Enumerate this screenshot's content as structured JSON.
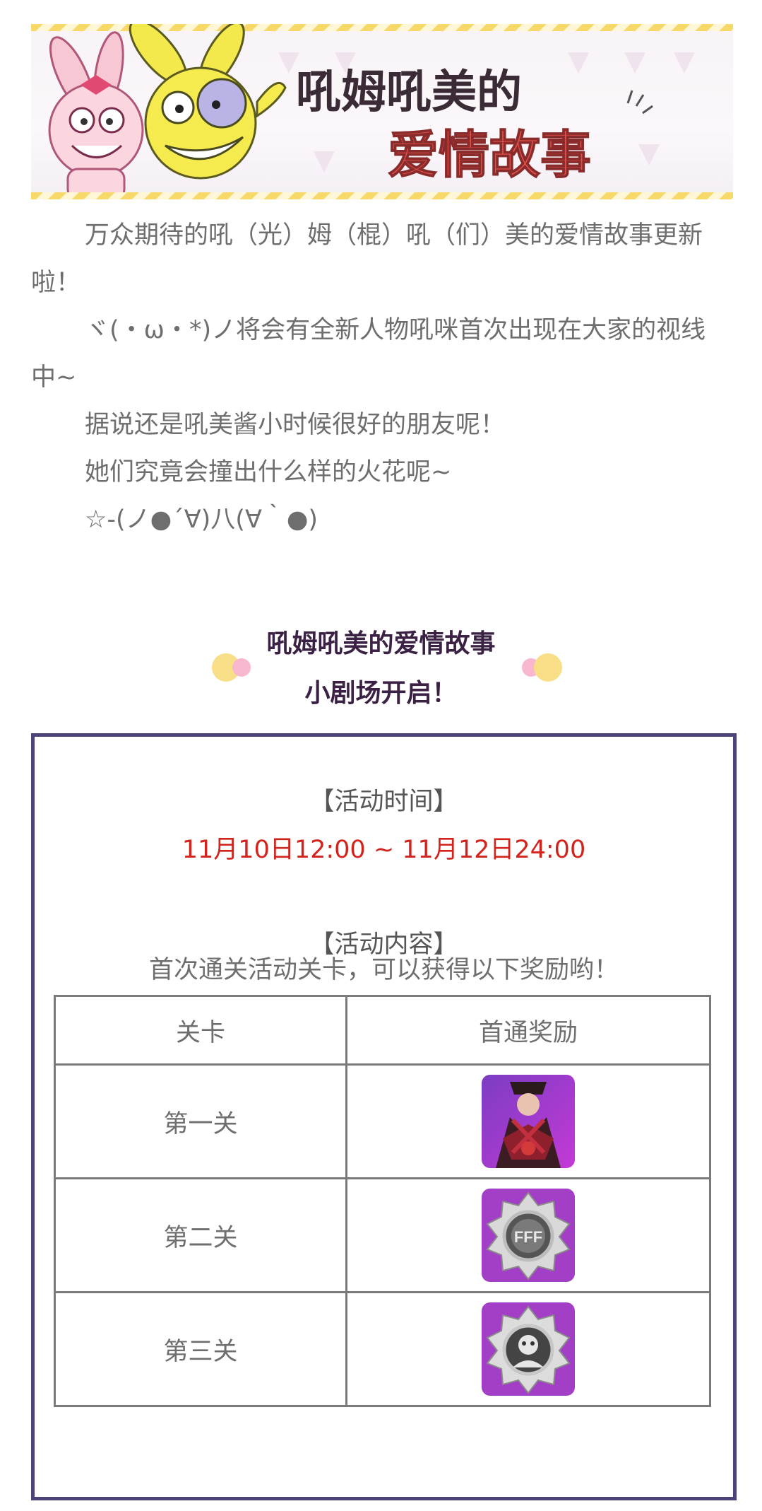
{
  "banner": {
    "title_line1": "吼姆吼美的",
    "title_line2": "爱情故事",
    "colors": {
      "title_dark": "#3a2b36",
      "title_red": "#e0504b",
      "bunny_yellow": "#f2e54a",
      "bunny_pink": "#f7b9c8"
    }
  },
  "intro": {
    "lines": [
      "万众期待的吼（光）姆（棍）吼（们）美的爱情故事更新啦！",
      "ヾ(・ω・*)ノ将会有全新人物吼咪首次出现在大家的视线中~",
      "据说还是吼美酱小时候很好的朋友呢！",
      "她们究竟会撞出什么样的火花呢~",
      "☆-(ノ●´∀)八(∀｀●)"
    ]
  },
  "subtitle": {
    "line1": "吼姆吼美的爱情故事",
    "line2": "小剧场开启！"
  },
  "event": {
    "time_label": "【活动时间】",
    "time_value": "11月10日12:00 ~ 11月12日24:00",
    "content_label": "【活动内容】",
    "content_desc": "首次通关活动关卡，可以获得以下奖励哟！",
    "table": {
      "headers": [
        "关卡",
        "首通奖励"
      ],
      "rows": [
        {
          "stage": "第一关",
          "reward_icon": "character-avatar-icon"
        },
        {
          "stage": "第二关",
          "reward_icon": "silver-badge-icon"
        },
        {
          "stage": "第三关",
          "reward_icon": "silver-badge-icon"
        }
      ]
    },
    "colors": {
      "border": "#4d4275",
      "time": "#d2241d"
    }
  }
}
